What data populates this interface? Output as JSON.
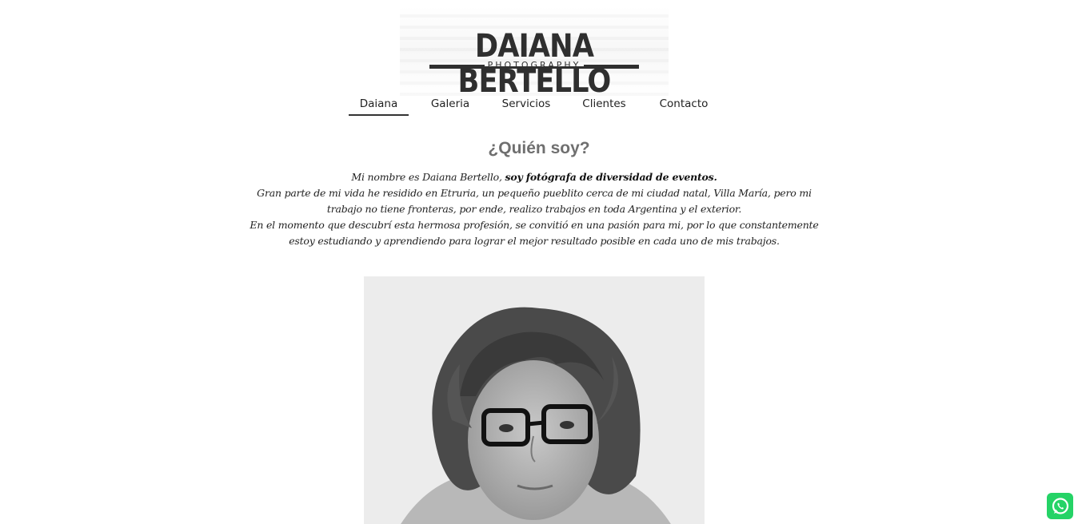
{
  "logo": {
    "name": "DAIANA BERTELLO",
    "subtitle": "PHOTOGRAPHY"
  },
  "nav": {
    "items": [
      {
        "label": "Daiana",
        "active": true
      },
      {
        "label": "Galeria",
        "active": false
      },
      {
        "label": "Servicios",
        "active": false
      },
      {
        "label": "Clientes",
        "active": false
      },
      {
        "label": "Contacto",
        "active": false
      }
    ]
  },
  "about": {
    "title": "¿Quién soy?",
    "intro_plain": "Mi nombre es Daiana Bertello, ",
    "intro_bold": "soy fotógrafa de diversidad de eventos.",
    "paragraph_2": "Gran parte de mi vida he residido en Etruria, un pequeño pueblito cerca de mi ciudad natal, Villa María, pero mi trabajo no tiene fronteras, por ende, realizo trabajos en toda Argentina y el exterior.",
    "paragraph_3": "En el momento que descubrí esta hermosa profesión, se convitió en una pasión para mi, por lo que constantemente estoy estudiando y aprendiendo para lograr el mejor resultado posible en cada uno de mis trabajos."
  },
  "portrait": {
    "kind": "black-and-white portrait photo"
  },
  "whatsapp": {
    "icon": "whatsapp-icon",
    "color": "#25d366"
  }
}
